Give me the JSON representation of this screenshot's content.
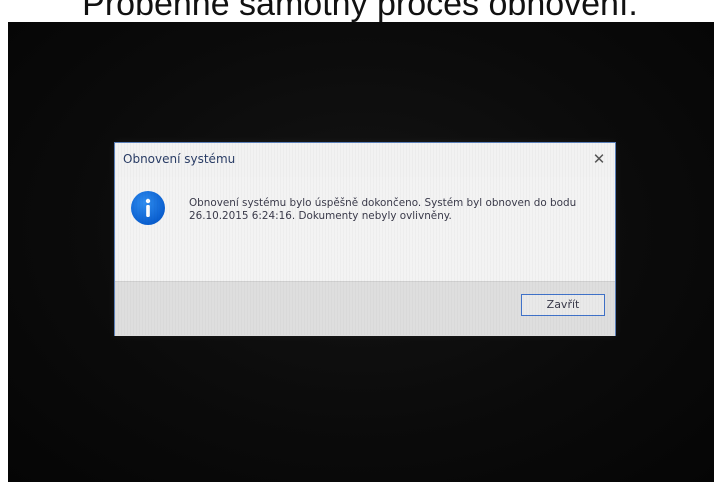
{
  "caption": "Proběhne samotný proces obnovení.",
  "dialog": {
    "title": "Obnovení systému",
    "message": "Obnovení systému bylo úspěšně dokončeno. Systém byl obnoven do bodu 26.10.2015 6:24:16. Dokumenty nebyly ovlivněny.",
    "close_icon": "close-icon",
    "info_icon": "info-icon",
    "close_button_label": "Zavřít"
  },
  "colors": {
    "accent": "#0a5fd0",
    "button_border": "#3f72c9",
    "title_text": "#2a3d66"
  }
}
